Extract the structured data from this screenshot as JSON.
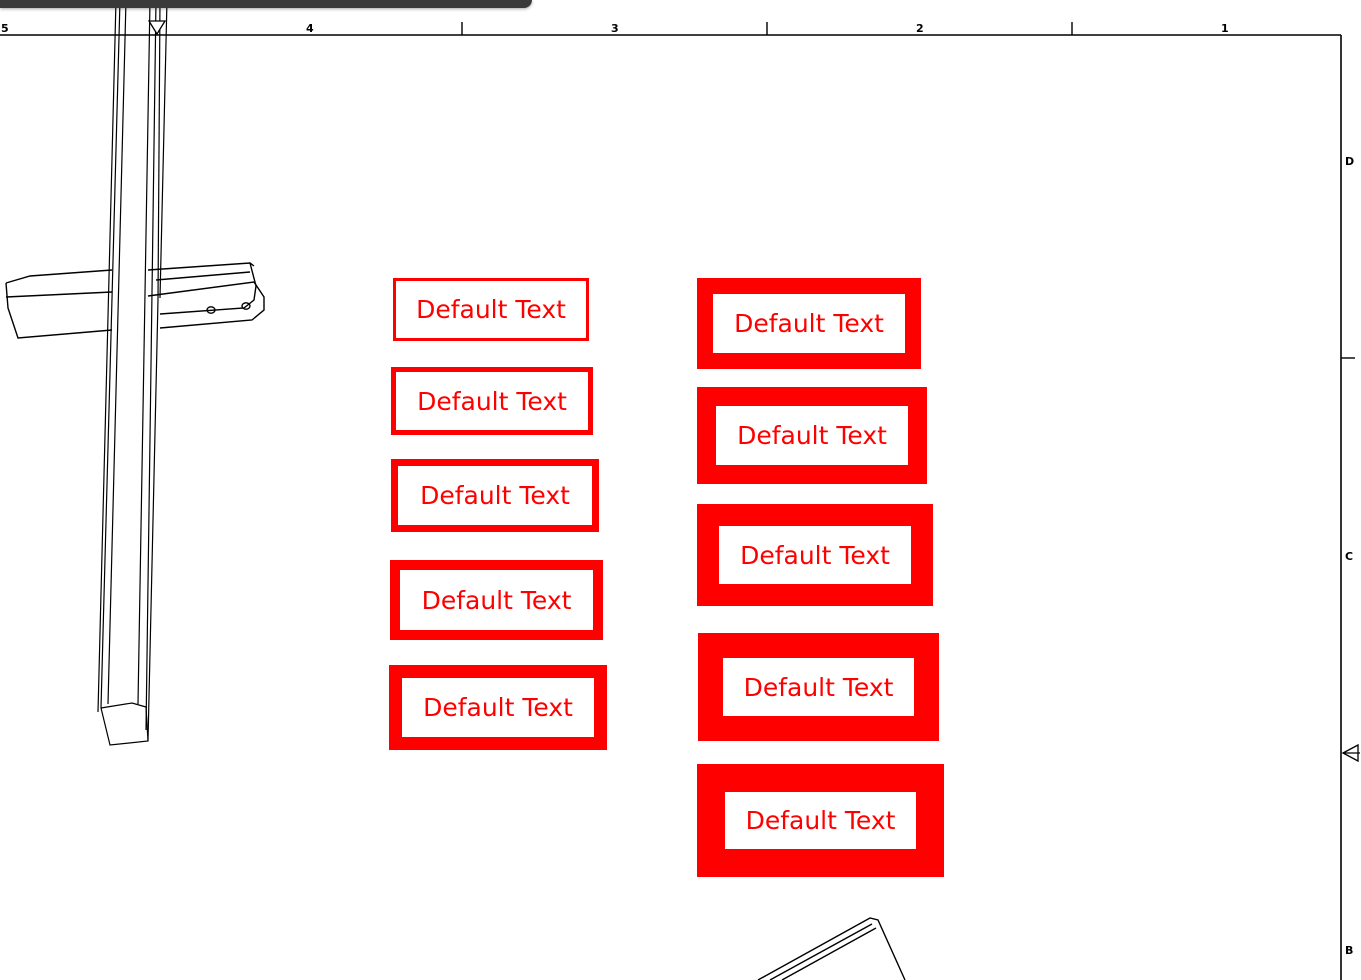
{
  "sheet": {
    "column_labels": [
      "5",
      "4",
      "3",
      "2",
      "1"
    ],
    "row_labels": [
      "D",
      "C",
      "B"
    ]
  },
  "theme": {
    "annotation_color": "#ff0000",
    "line_color": "#000000",
    "toolbar_color": "#3a3a3a"
  },
  "annotations": {
    "left": [
      {
        "text": "Default Text"
      },
      {
        "text": "Default Text"
      },
      {
        "text": "Default Text"
      },
      {
        "text": "Default Text"
      },
      {
        "text": "Default Text"
      }
    ],
    "right": [
      {
        "text": "Default Text"
      },
      {
        "text": "Default Text"
      },
      {
        "text": "Default Text"
      },
      {
        "text": "Default Text"
      },
      {
        "text": "Default Text"
      }
    ]
  },
  "icons": {
    "top_marker": "triangle-down-icon",
    "side_marker": "triangle-left-icon"
  }
}
